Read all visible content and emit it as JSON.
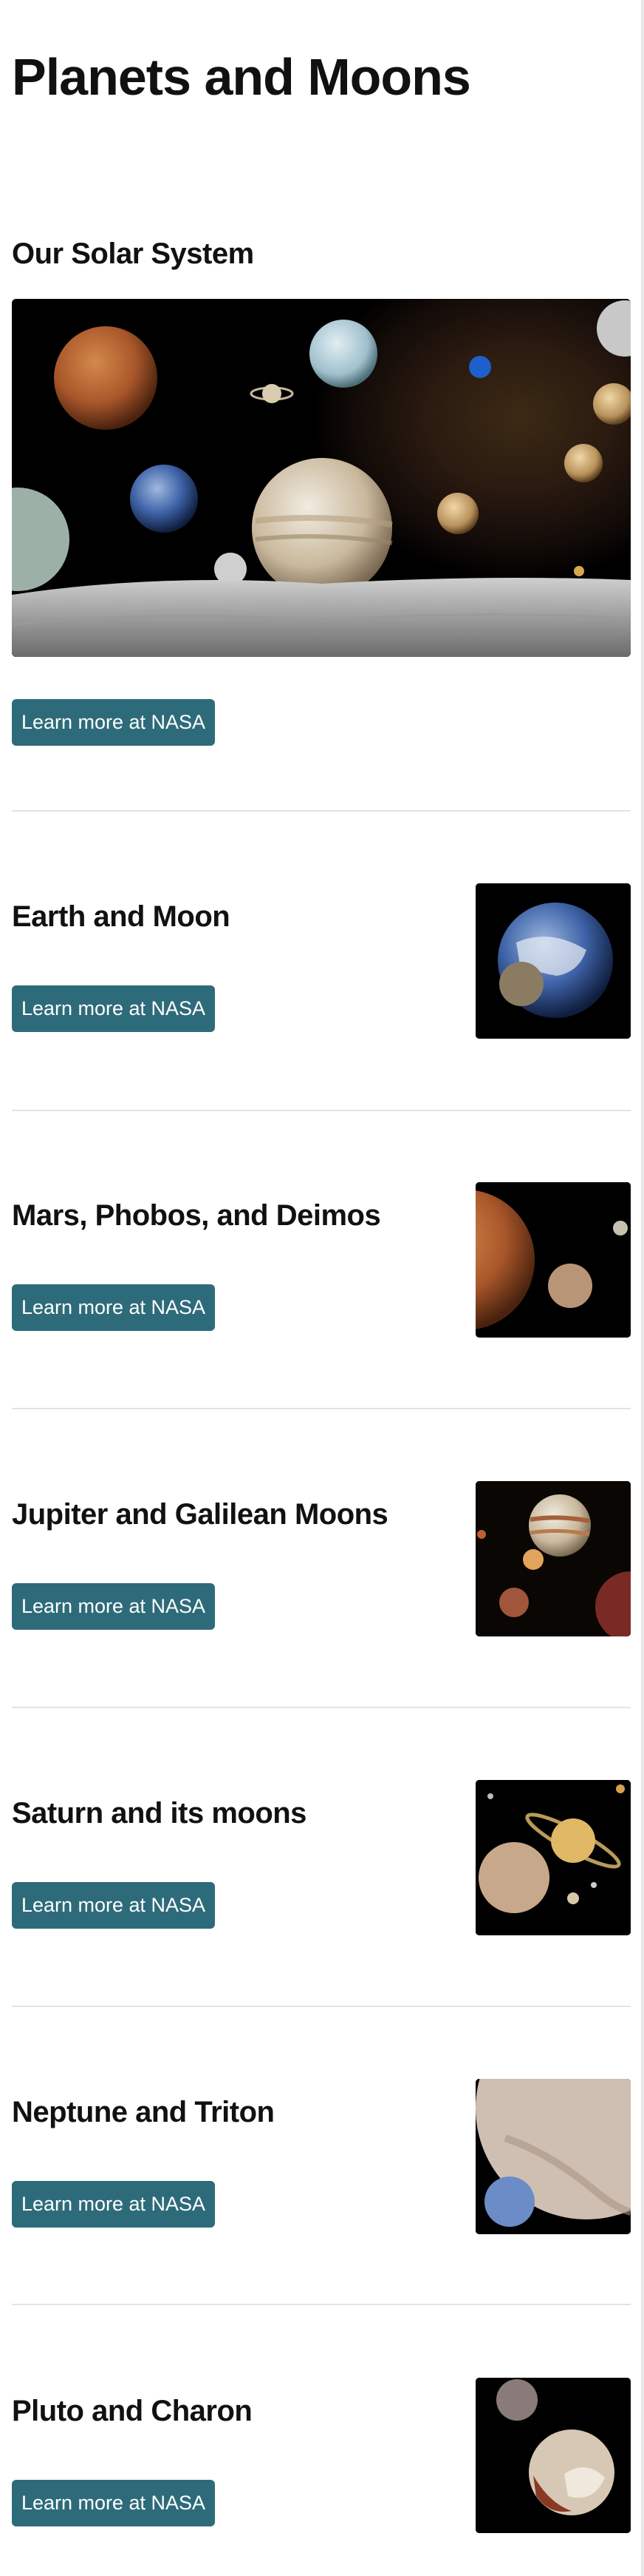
{
  "page": {
    "title": "Planets and Moons"
  },
  "hero": {
    "title": "Our Solar System",
    "image_alt": "solar-system-montage",
    "button_label": "Learn more at NASA"
  },
  "items": [
    {
      "title": "Earth and Moon",
      "button_label": "Learn more at NASA"
    },
    {
      "title": "Mars, Phobos, and Deimos",
      "button_label": "Learn more at NASA"
    },
    {
      "title": "Jupiter and Galilean Moons",
      "button_label": "Learn more at NASA"
    },
    {
      "title": "Saturn and its moons",
      "button_label": "Learn more at NASA"
    },
    {
      "title": "Neptune and Triton",
      "button_label": "Learn more at NASA"
    },
    {
      "title": "Pluto and Charon",
      "button_label": "Learn more at NASA"
    }
  ],
  "colors": {
    "button": "#2e6b7a",
    "divider": "#e3e3e3"
  }
}
